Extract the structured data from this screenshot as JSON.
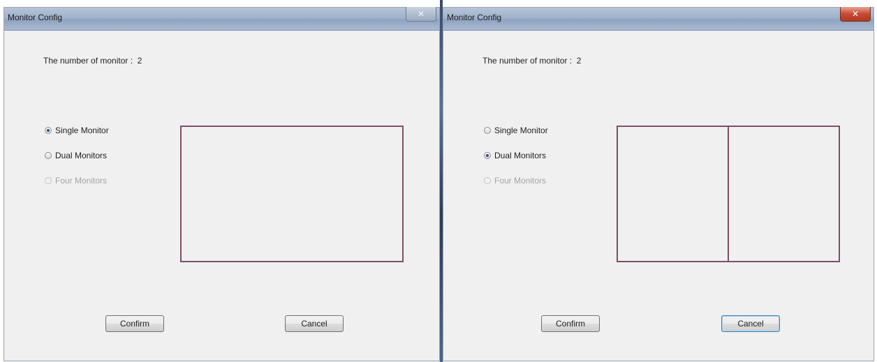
{
  "dialogs": [
    {
      "title": "Monitor Config",
      "close_glyph": "✕",
      "count_label": "The number of monitor :  2",
      "options": [
        {
          "label": "Single Monitor",
          "checked": true,
          "disabled": false
        },
        {
          "label": "Dual Monitors",
          "checked": false,
          "disabled": false
        },
        {
          "label": "Four Monitors",
          "checked": false,
          "disabled": true
        }
      ],
      "preview_panes": 1,
      "confirm_label": "Confirm",
      "cancel_label": "Cancel"
    },
    {
      "title": "Monitor Config",
      "close_glyph": "✕",
      "count_label": "The number of monitor :  2",
      "options": [
        {
          "label": "Single Monitor",
          "checked": false,
          "disabled": false
        },
        {
          "label": "Dual Monitors",
          "checked": true,
          "disabled": false
        },
        {
          "label": "Four Monitors",
          "checked": false,
          "disabled": true
        }
      ],
      "preview_panes": 2,
      "confirm_label": "Confirm",
      "cancel_label": "Cancel"
    }
  ],
  "colors": {
    "preview_border": "#7d4f67",
    "window_bg": "#f0f0f0",
    "close_active": "#c74a33"
  }
}
